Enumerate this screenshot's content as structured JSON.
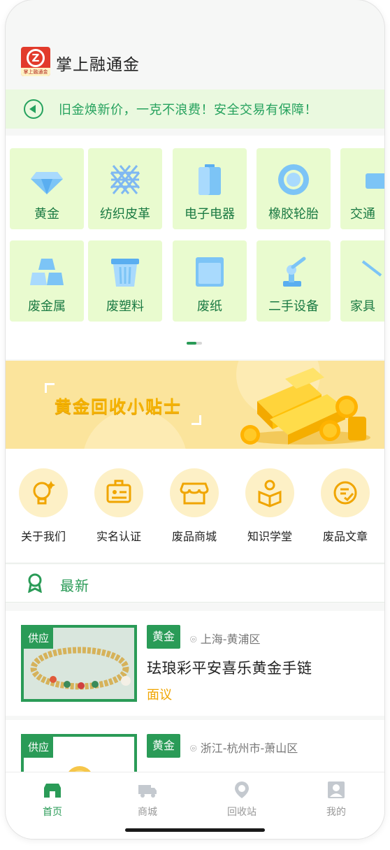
{
  "app": {
    "title": "掌上融通金",
    "logo_text": "掌上融通金"
  },
  "notice": {
    "text": "旧金焕新价，一克不浪费！安全交易有保障！",
    "icon": "speaker-icon"
  },
  "categories": [
    {
      "label": "黄金",
      "icon": "diamond-icon"
    },
    {
      "label": "纺织皮革",
      "icon": "fabric-icon"
    },
    {
      "label": "电子电器",
      "icon": "battery-icon"
    },
    {
      "label": "橡胶轮胎",
      "icon": "tire-icon"
    },
    {
      "label": "交通",
      "icon": "vehicle-icon"
    },
    {
      "label": "废金属",
      "icon": "metal-ingots-icon"
    },
    {
      "label": "废塑料",
      "icon": "plastic-bin-icon"
    },
    {
      "label": "废纸",
      "icon": "paper-icon"
    },
    {
      "label": "二手设备",
      "icon": "robot-arm-icon"
    },
    {
      "label": "家具",
      "icon": "furniture-icon"
    }
  ],
  "carousel": {
    "pages": 2,
    "current": 1
  },
  "banner": {
    "title": "黄金回收小贴士"
  },
  "quick_links": [
    {
      "label": "关于我们",
      "icon": "lightbulb-icon"
    },
    {
      "label": "实名认证",
      "icon": "id-card-icon"
    },
    {
      "label": "废品商城",
      "icon": "store-icon"
    },
    {
      "label": "知识学堂",
      "icon": "reading-icon"
    },
    {
      "label": "废品文章",
      "icon": "article-icon"
    }
  ],
  "latest": {
    "label": "最新",
    "icon": "award-ribbon-icon"
  },
  "listings": [
    {
      "tag": "供应",
      "category": "黄金",
      "location": "上海-黄浦区",
      "name": "珐琅彩平安喜乐黄金手链",
      "price": "面议"
    },
    {
      "tag": "供应",
      "category": "黄金",
      "location": "浙江-杭州市-萧山区",
      "name": "",
      "price": ""
    }
  ],
  "tabbar": [
    {
      "label": "首页",
      "icon": "home-icon",
      "active": true
    },
    {
      "label": "商城",
      "icon": "truck-icon",
      "active": false
    },
    {
      "label": "回收站",
      "icon": "recycle-location-icon",
      "active": false
    },
    {
      "label": "我的",
      "icon": "profile-icon",
      "active": false
    }
  ],
  "colors": {
    "primary": "#2a9b57",
    "notice_bg": "#eaf9df",
    "category_bg": "#e9fbcf",
    "banner_bg": "#fbe49c",
    "price": "#f0a500"
  }
}
